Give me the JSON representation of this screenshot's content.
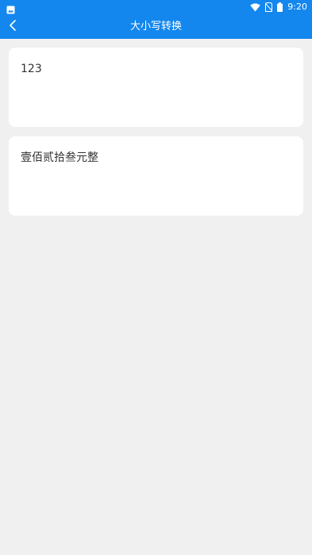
{
  "status_bar": {
    "time": "9:20",
    "icons": [
      "image-icon",
      "wifi-icon",
      "no-sim-icon",
      "battery-icon"
    ]
  },
  "nav": {
    "title": "大小写转换",
    "back_icon": "chevron-left-icon"
  },
  "converter": {
    "input_value": "123",
    "output_value": "壹佰贰拾叁元整"
  },
  "colors": {
    "header": "#1487ee",
    "background": "#f0f0f0",
    "card": "#ffffff",
    "text": "#333333"
  }
}
